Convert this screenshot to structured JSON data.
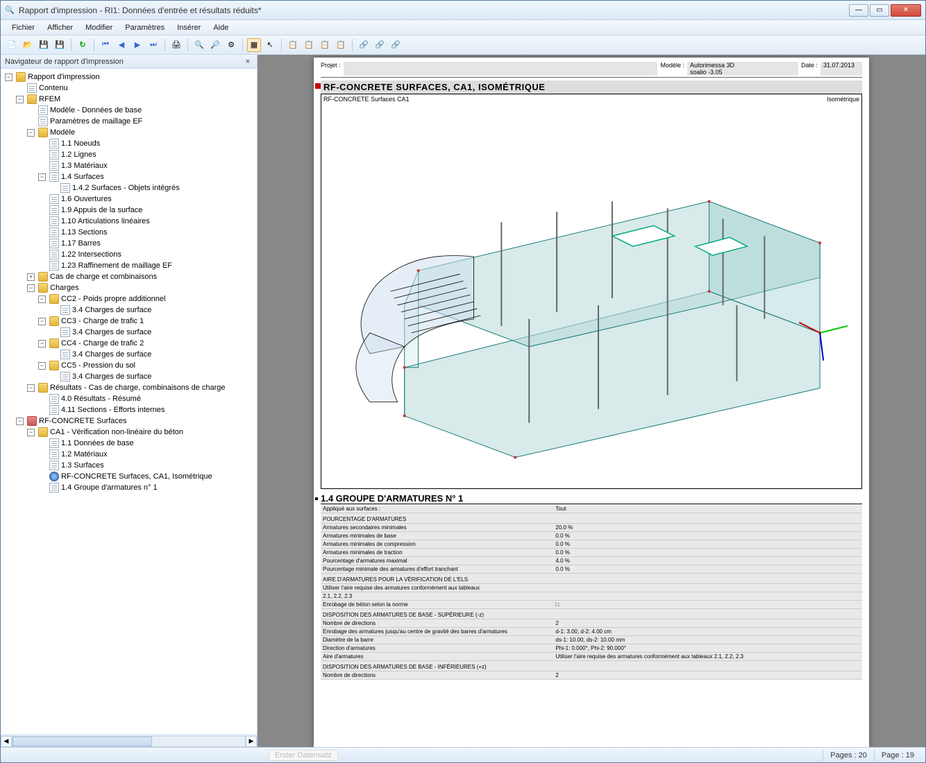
{
  "window": {
    "title": "Rapport d'impression - RI1: Données d'entrée et résultats réduits*"
  },
  "menu": {
    "items": [
      "Fichier",
      "Afficher",
      "Modifier",
      "Paramètres",
      "Insérer",
      "Aide"
    ]
  },
  "navigator": {
    "title": "Navigateur de rapport d'impression"
  },
  "tree": {
    "root": "Rapport d'impression",
    "contenu": "Contenu",
    "rfem": "RFEM",
    "modele_base": "Modèle - Données de base",
    "param_maillage": "Paramètres de maillage EF",
    "modele": "Modèle",
    "noeuds": "1.1 Noeuds",
    "lignes": "1.2 Lignes",
    "materiaux": "1.3 Matériaux",
    "surfaces": "1.4 Surfaces",
    "surfaces_obj": "1.4.2 Surfaces - Objets intégrés",
    "ouvertures": "1.6 Ouvertures",
    "appuis": "1.9 Appuis de la surface",
    "articulations": "1.10 Articulations linéaires",
    "sections": "1.13 Sections",
    "barres": "1.17 Barres",
    "intersections": "1.22 Intersections",
    "raffinement": "1.23 Raffinement de maillage EF",
    "cas_charge": "Cas de charge et combinaisons",
    "charges": "Charges",
    "cc2": "CC2 - Poids propre additionnel",
    "cc2_34": "3.4 Charges de surface",
    "cc3": "CC3 - Charge de trafic 1",
    "cc3_34": "3.4 Charges de surface",
    "cc4": "CC4 - Charge de trafic 2",
    "cc4_34": "3.4 Charges de surface",
    "cc5": "CC5 - Pression du sol",
    "cc5_34": "3.4 Charges de surface",
    "resultats": "Résultats - Cas de charge, combinaisons de charge",
    "res40": "4.0 Résultats - Résumé",
    "res411": "4.11 Sections - Efforts internes",
    "rfconcrete": "RF-CONCRETE Surfaces",
    "ca1": "CA1 - Vérification non-linéaire du béton",
    "ca1_11": "1.1 Données de base",
    "ca1_12": "1.2 Matériaux",
    "ca1_13": "1.3 Surfaces",
    "ca1_iso": "RF-CONCRETE Surfaces, CA1, Isométrique",
    "ca1_14": "1.4 Groupe d'armatures n° 1"
  },
  "page": {
    "projet_lbl": "Projet :",
    "modele_lbl": "Modèle :",
    "modele_val": "Autorimessa 3D",
    "modele_val2": "soalio  -3.05",
    "date_lbl": "Date :",
    "date_val": "31.07.2013",
    "heading": "RF-CONCRETE SURFACES, CA1, ISOMÉTRIQUE",
    "iso_left": "RF-CONCRETE Surfaces CA1",
    "iso_right": "Isométrique",
    "section14": "1.4 GROUPE D'ARMATURES N° 1",
    "applique": {
      "k": "Appliqué aux surfaces :",
      "v": "Tout"
    },
    "pct_h": "POURCENTAGE D'ARMATURES",
    "rows_pct": [
      {
        "k": "Armatures secondaires minimales",
        "v": "20.0 %"
      },
      {
        "k": "Armatures minimales de base",
        "v": "0.0 %"
      },
      {
        "k": "Armatures minimales de compression",
        "v": "0.0 %"
      },
      {
        "k": "Armatures minimales de traction",
        "v": "0.0 %"
      },
      {
        "k": "Pourcentage d'armatures maximal",
        "v": "4.0 %"
      },
      {
        "k": "Pourcentage minimale des armatures d'effort tranchant",
        "v": "0.0 %"
      }
    ],
    "aire_h": "AIRE D'ARMATURES POUR LA VÉRIFICATION DE L'ELS",
    "rows_aire": [
      {
        "k": "Utiliser l'aire requise des armatures conformément aux tableaux",
        "v": ""
      },
      {
        "k": "2.1, 2.2, 2.3",
        "v": ""
      },
      {
        "k": "Enrobage de béton selon la norme",
        "v": "□"
      }
    ],
    "disp_sup_h": "DISPOSITION DES ARMATURES DE BASE - SUPÉRIEURE (-z)",
    "rows_sup": [
      {
        "k": "Nombre de directions",
        "v": "2"
      },
      {
        "k": "Enrobage des armatures jusqu'au centre de gravité des barres d'armatures",
        "v": "d-1: 3.00, d-2: 4.00 cm"
      },
      {
        "k": "Diamètre de la barre",
        "v": "ds-1: 10.00, ds-2: 10.00 mm"
      },
      {
        "k": "Direction d'armatures",
        "v": "Phi-1: 0.000°, Phi-2: 90.000°"
      },
      {
        "k": "Aire d'armatures",
        "v": "Utiliser l'aire requise des armatures conformément aux tableaux 2.1, 2.2, 2.3"
      }
    ],
    "disp_inf_h": "DISPOSITION DES ARMATURES DE BASE - INFÉRIEURES (+z)",
    "rows_inf": [
      {
        "k": "Nombre de directions",
        "v": "2"
      }
    ]
  },
  "status": {
    "ghost": "Erster Datensatz",
    "pages_lbl": "Pages :",
    "pages_val": "20",
    "page_lbl": "Page :",
    "page_val": "19"
  }
}
